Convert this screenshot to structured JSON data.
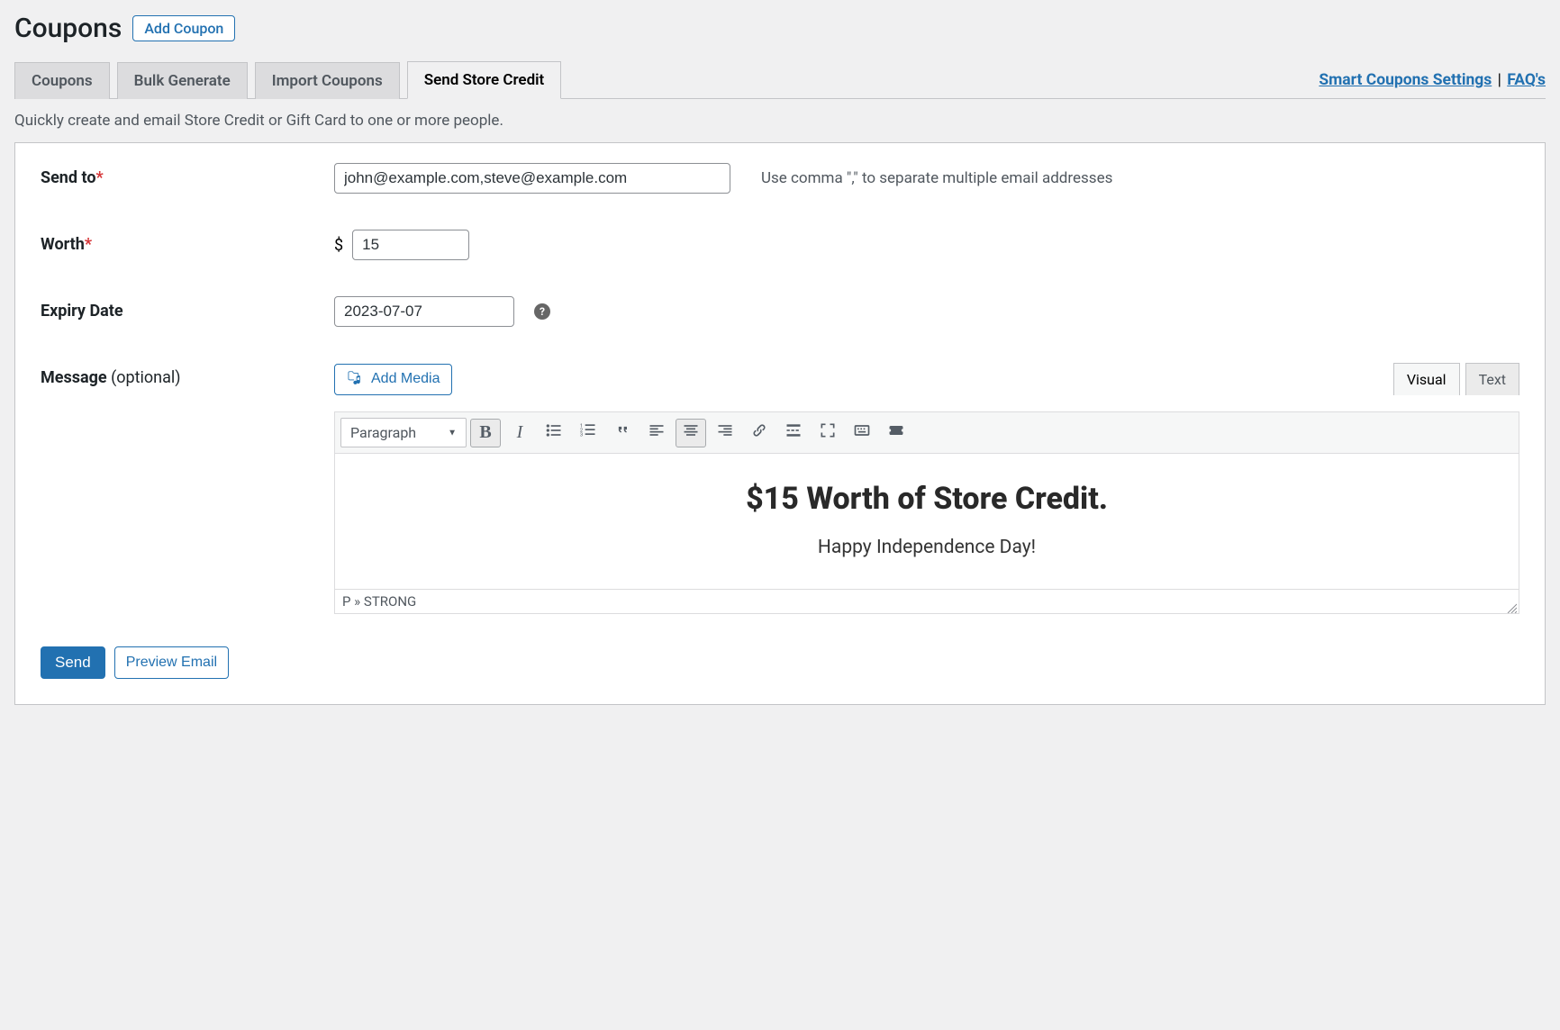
{
  "header": {
    "title": "Coupons",
    "add_button": "Add Coupon"
  },
  "tabs": [
    {
      "label": "Coupons",
      "active": false
    },
    {
      "label": "Bulk Generate",
      "active": false
    },
    {
      "label": "Import Coupons",
      "active": false
    },
    {
      "label": "Send Store Credit",
      "active": true
    }
  ],
  "links": {
    "settings": "Smart Coupons Settings",
    "sep": " | ",
    "faq": "FAQ's"
  },
  "intro": "Quickly create and email Store Credit or Gift Card to one or more people.",
  "form": {
    "send_to": {
      "label": "Send to",
      "required_mark": "*",
      "value": "john@example.com,steve@example.com",
      "help": "Use comma \",\" to separate multiple email addresses"
    },
    "worth": {
      "label": "Worth",
      "required_mark": "*",
      "currency_prefix": "$",
      "value": "15"
    },
    "expiry": {
      "label": "Expiry Date",
      "value": "2023-07-07",
      "help_icon": "?"
    },
    "message": {
      "label": "Message ",
      "optional_label": "(optional)"
    }
  },
  "editor": {
    "add_media": "Add Media",
    "tab_visual": "Visual",
    "tab_text": "Text",
    "format_select": "Paragraph",
    "content": {
      "line1": "$15 Worth of Store Credit.",
      "line2": "Happy Independence Day!"
    },
    "path": "P » STRONG"
  },
  "actions": {
    "send": "Send",
    "preview": "Preview Email"
  }
}
